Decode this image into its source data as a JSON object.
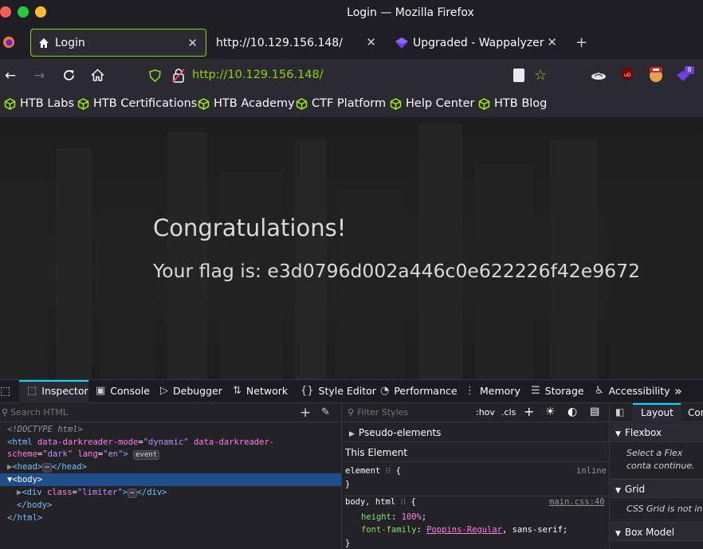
{
  "window": {
    "title": "Login — Mozilla Firefox"
  },
  "tabs": [
    {
      "label": "Login"
    },
    {
      "label": "http://10.129.156.148/"
    },
    {
      "label": "Upgraded - Wappalyzer"
    }
  ],
  "nav": {
    "url_prefix": "http://",
    "url_host": "10.129.156.148",
    "url_suffix": "/",
    "ext_badge": "8"
  },
  "bookmarks": [
    "HTB Labs",
    "HTB Certifications",
    "HTB Academy",
    "CTF Platform",
    "Help Center",
    "HTB Blog"
  ],
  "page": {
    "heading": "Congratulations!",
    "flag_text": "Your flag is: e3d0796d002a446c0e622226f42e9672"
  },
  "devtools": {
    "tabs": [
      "Inspector",
      "Console",
      "Debugger",
      "Network",
      "Style Editor",
      "Performance",
      "Memory",
      "Storage",
      "Accessibility"
    ],
    "search_placeholder": "Search HTML",
    "filter_placeholder": "Filter Styles",
    "hov": ":hov",
    "cls": ".cls",
    "html": {
      "doctype": "<!DOCTYPE html>",
      "html_open_1": "<html",
      "attr1_name": "data-darkreader-mode",
      "attr1_val": "\"dynamic\"",
      "attr2_name_a": "data-darkreader-",
      "attr2_name_b": "scheme",
      "attr2_val": "\"dark\"",
      "attr3_name": "lang",
      "attr3_val": "\"en\"",
      "event_badge": "event",
      "head": "<head>",
      "head_close": "</head>",
      "body": "<body>",
      "div_open": "<div",
      "div_class_name": "class",
      "div_class_val": "\"limiter\"",
      "div_close": "</div>",
      "body_close": "</body>",
      "html_close": "</html>"
    },
    "rules": {
      "pseudo": "Pseudo-elements",
      "this_element": "This Element",
      "element_sel": "element",
      "inline": "inline",
      "sel2": "body, html",
      "source": "main.css:40",
      "prop1": "height",
      "val1": "100%",
      "prop2": "font-family",
      "val2a": "Poppins-Regular",
      "val2b": ", sans-serif;"
    },
    "layout": {
      "tab_layout": "Layout",
      "tab_computed": "Cor",
      "flexbox": "Flexbox",
      "flex_msg": "Select a Flex conta continue.",
      "grid": "Grid",
      "grid_msg": "CSS Grid is not in",
      "box": "Box Model"
    }
  },
  "colors": {
    "accent": "#8bd600",
    "bg": "#1c1b22",
    "toolbar": "#2b2a33"
  }
}
